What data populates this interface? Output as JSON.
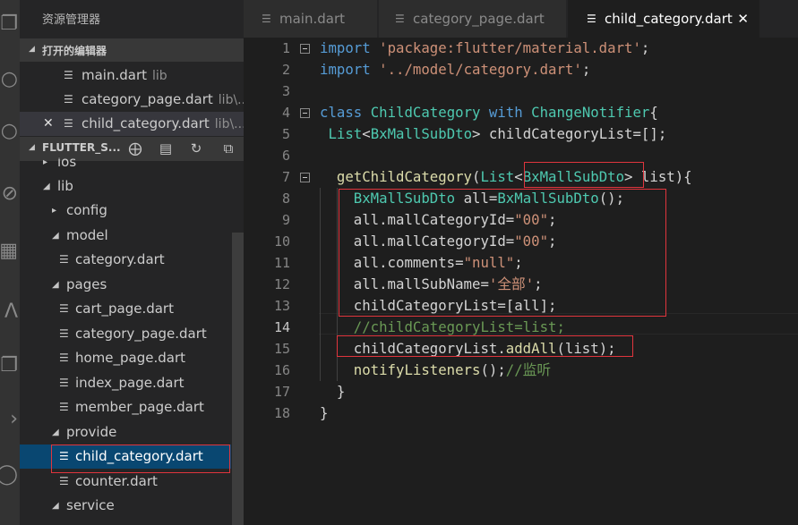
{
  "sidebar": {
    "title": "资源管理器",
    "open_editors_header": "打开的编辑器",
    "open_editors": [
      {
        "name": "main.dart",
        "path": "lib"
      },
      {
        "name": "category_page.dart",
        "path": "lib\\..."
      },
      {
        "name": "child_category.dart",
        "path": "lib\\..."
      }
    ],
    "project_header": "FLUTTER_S...",
    "tree": [
      {
        "label": "ios"
      },
      {
        "label": "lib"
      },
      {
        "label": "config"
      },
      {
        "label": "model"
      },
      {
        "label": "category.dart"
      },
      {
        "label": "pages"
      },
      {
        "label": "cart_page.dart"
      },
      {
        "label": "category_page.dart"
      },
      {
        "label": "home_page.dart"
      },
      {
        "label": "index_page.dart"
      },
      {
        "label": "member_page.dart"
      },
      {
        "label": "provide"
      },
      {
        "label": "child_category.dart"
      },
      {
        "label": "counter.dart"
      },
      {
        "label": "service"
      }
    ]
  },
  "tabs": [
    {
      "label": "main.dart"
    },
    {
      "label": "category_page.dart"
    },
    {
      "label": "child_category.dart"
    }
  ],
  "editor": {
    "line_numbers": [
      "1",
      "2",
      "3",
      "4",
      "5",
      "6",
      "7",
      "8",
      "9",
      "10",
      "11",
      "12",
      "13",
      "14",
      "15",
      "16",
      "17",
      "18"
    ],
    "current_line": "14",
    "code": {
      "l1_kw": "import",
      "l1_str": "'package:flutter/material.dart'",
      "l1_end": ";",
      "l2_kw": "import",
      "l2_str": "'../model/category.dart'",
      "l2_end": ";",
      "l4_kw1": "class",
      "l4_ty1": "ChildCategory",
      "l4_kw2": "with",
      "l4_ty2": "ChangeNotifier",
      "l4_end": "{",
      "l5_ty1": "List",
      "l5_p1": "<",
      "l5_ty2": "BxMallSubDto",
      "l5_rest": "> childCategoryList=[];",
      "l7_fn": "getChildCategory",
      "l7_p1": "(",
      "l7_ty1": "List",
      "l7_p2": "<",
      "l7_ty2": "BxMallSubDto",
      "l7_rest": "> list){",
      "l8_ty1": "BxMallSubDto",
      "l8_mid": " all=",
      "l8_fn": "BxMallSubDto",
      "l8_end": "();",
      "l9_a": "all.mallCategoryId=",
      "l9_s": "\"00\"",
      "l9_e": ";",
      "l10_a": "all.mallCategoryId=",
      "l10_s": "\"00\"",
      "l10_e": ";",
      "l11_a": "all.comments=",
      "l11_s": "\"null\"",
      "l11_e": ";",
      "l12_a": "all.mallSubName=",
      "l12_s": "'全部'",
      "l12_e": ";",
      "l13": "childCategoryList=[all];",
      "l14_cmt": "//childCategoryList=list;",
      "l15_a": "childCategoryList.",
      "l15_fn": "addAll",
      "l15_e": "(list);",
      "l16_fn": "notifyListeners",
      "l16_e": "();",
      "l16_cmt": "//监听",
      "l17": "}",
      "l18": "}"
    }
  },
  "colors": {
    "keyword": "#569cd6",
    "string": "#ce9178",
    "type": "#4ec9b0",
    "function": "#dcdcaa",
    "comment": "#6a9955",
    "highlight_box": "#e0353d",
    "selected_file": "#094771"
  },
  "icons": [
    "files-icon",
    "search-icon",
    "source-control-icon",
    "debug-icon",
    "extensions-icon",
    "dart-file-icon",
    "new-file-icon",
    "new-folder-icon",
    "refresh-icon",
    "collapse-all-icon",
    "close-icon"
  ]
}
